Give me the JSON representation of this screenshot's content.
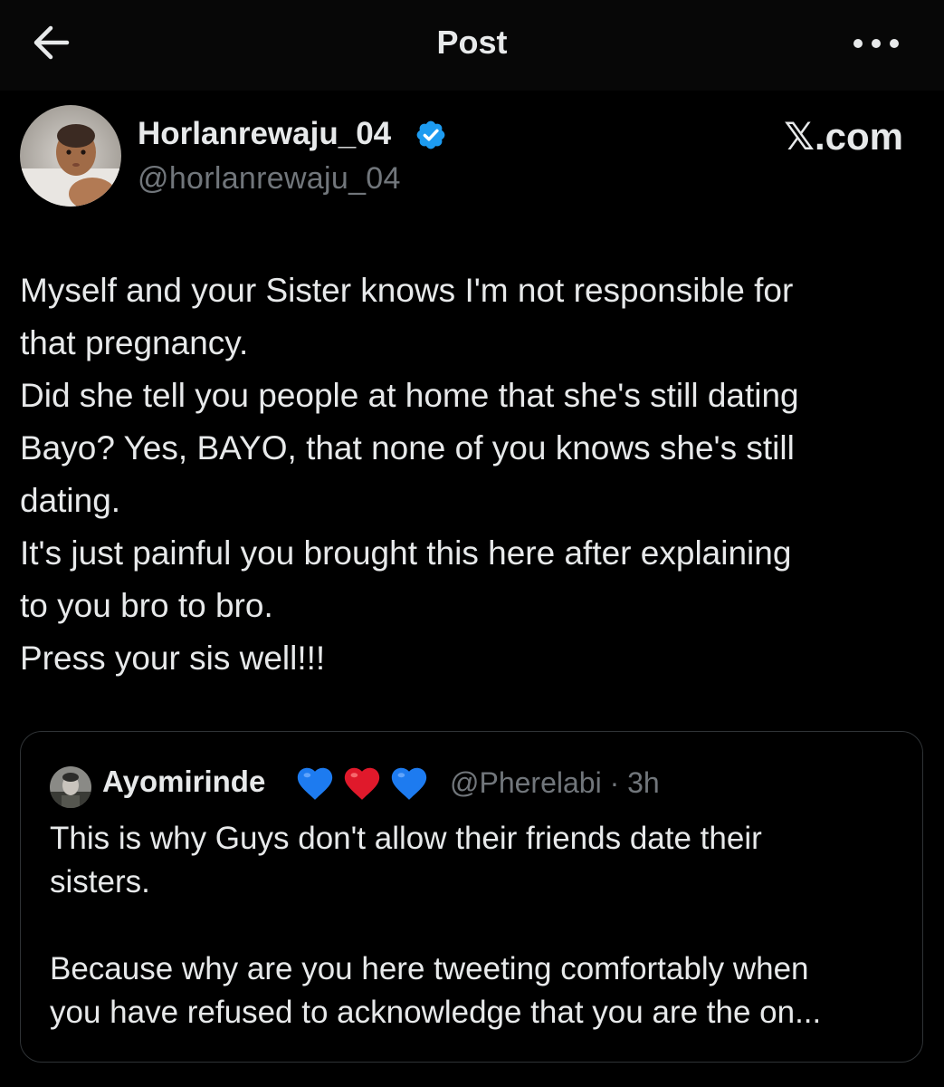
{
  "header": {
    "title": "Post",
    "back_icon": "arrow-left-icon",
    "more_icon": "more-horizontal-icon"
  },
  "post": {
    "author": {
      "display_name": "Horlanrewaju_04",
      "handle": "@horlanrewaju_04",
      "verified": true,
      "verified_color": "#1d9bf0"
    },
    "watermark": "𝕏.com",
    "text_lines": [
      "Myself and your Sister knows I'm not responsible for",
      "that pregnancy.",
      "Did she tell you people at home that she's still dating",
      "Bayo? Yes, BAYO, that none of you knows she's still",
      "dating.",
      "It's just painful you brought this here after explaining",
      "to you bro to bro.",
      "Press your sis well!!!"
    ]
  },
  "quote": {
    "author": {
      "display_name": "Ayomirinde",
      "emojis": [
        "💙",
        "❤️",
        "💙"
      ],
      "handle_time": "@Pherelabi · 3h"
    },
    "text_lines_1": [
      "This is why Guys don't allow their friends date their",
      "sisters."
    ],
    "text_lines_2": [
      "Because why are you here tweeting comfortably when",
      "you have refused to acknowledge that you are the on..."
    ]
  },
  "colors": {
    "background": "#000000",
    "text": "#e7e9ea",
    "secondary": "#71767b",
    "border": "#2f3336",
    "heart_blue": "#1d7bf0",
    "heart_red": "#e0192b"
  }
}
